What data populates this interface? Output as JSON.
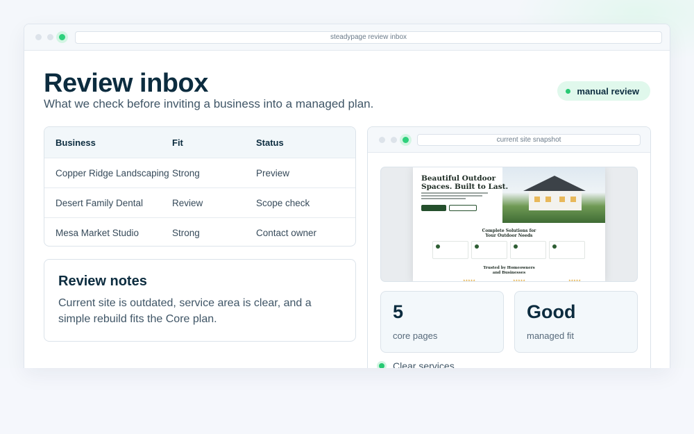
{
  "window": {
    "url": "steadypage review inbox"
  },
  "header": {
    "title": "Review inbox",
    "subtitle": "What we check before inviting a business into a managed plan.",
    "badge": "manual review"
  },
  "table": {
    "headers": [
      "Business",
      "Fit",
      "Status"
    ],
    "rows": [
      [
        "Copper Ridge Landscaping",
        "Strong",
        "Preview"
      ],
      [
        "Desert Family Dental",
        "Review",
        "Scope check"
      ],
      [
        "Mesa Market Studio",
        "Strong",
        "Contact owner"
      ]
    ]
  },
  "notes": {
    "title": "Review notes",
    "body": "Current site is outdated, service area is clear, and a simple rebuild fits the Core plan."
  },
  "snapshot": {
    "url": "current site snapshot",
    "hero_line1": "Beautiful Outdoor",
    "hero_line2": "Spaces. Built to Last.",
    "section_line1": "Complete Solutions for",
    "section_line2": "Your Outdoor Needs",
    "trusted_line1": "Trusted by Homeowners",
    "trusted_line2": "and Businesses"
  },
  "stats": [
    {
      "value": "5",
      "label": "core pages"
    },
    {
      "value": "Good",
      "label": "managed fit"
    }
  ],
  "checklist": [
    "Clear services"
  ],
  "colors": {
    "accent": "#27c973",
    "text": "#0c2c3f"
  }
}
